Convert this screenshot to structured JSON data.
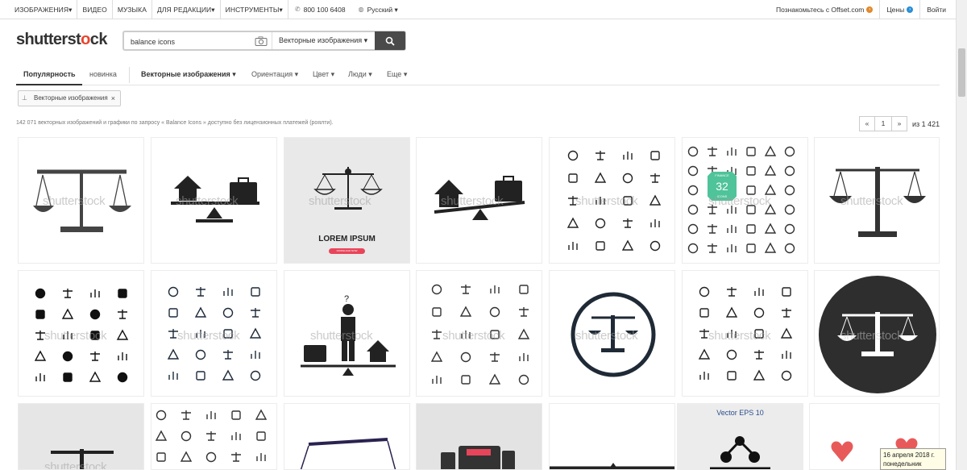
{
  "topbar": {
    "nav": [
      "ИЗОБРАЖЕНИЯ▾",
      "ВИДЕО",
      "МУЗЫКА",
      "ДЛЯ РЕДАКЦИИ▾",
      "ИНСТРУМЕНТЫ▾"
    ],
    "phone": "800 100 6408",
    "language": "Русский ▾",
    "offset": "Познакомьтесь с Offset.com",
    "prices": "Цены",
    "login": "Войти"
  },
  "logo": {
    "part1": "shutterst",
    "part2": "ck",
    "o_letter": "o"
  },
  "search": {
    "query": "balance icons",
    "type": "Векторные изображения ▾"
  },
  "sort": {
    "popular": "Популярность",
    "new": "новинка",
    "vector": "Векторные изображения ▾",
    "orientation": "Ориентация ▾",
    "color": "Цвет ▾",
    "people": "Люди ▾",
    "more": "Еще ▾"
  },
  "chip": {
    "label": "Векторные изображения",
    "close": "×"
  },
  "results": "142 071 векторных изображений и графики по запросу « Balance Icons » доступно без лицензионных платежей (роялти).",
  "pager": {
    "prev": "«",
    "page": "1",
    "next": "»",
    "of": "из 1 421"
  },
  "watermark": "shutterstock",
  "tiles": {
    "lorem": "LOREM IPSUM",
    "lorem_btn": "DOWNLOAD NOW",
    "finance_badge": "32",
    "finance_top": "FINANCE",
    "finance_bottom": "ICONS",
    "vector_eps": "Vector EPS 10"
  },
  "tooltip": {
    "line1": "16 апреля 2018 г.",
    "line2": "понедельник"
  }
}
